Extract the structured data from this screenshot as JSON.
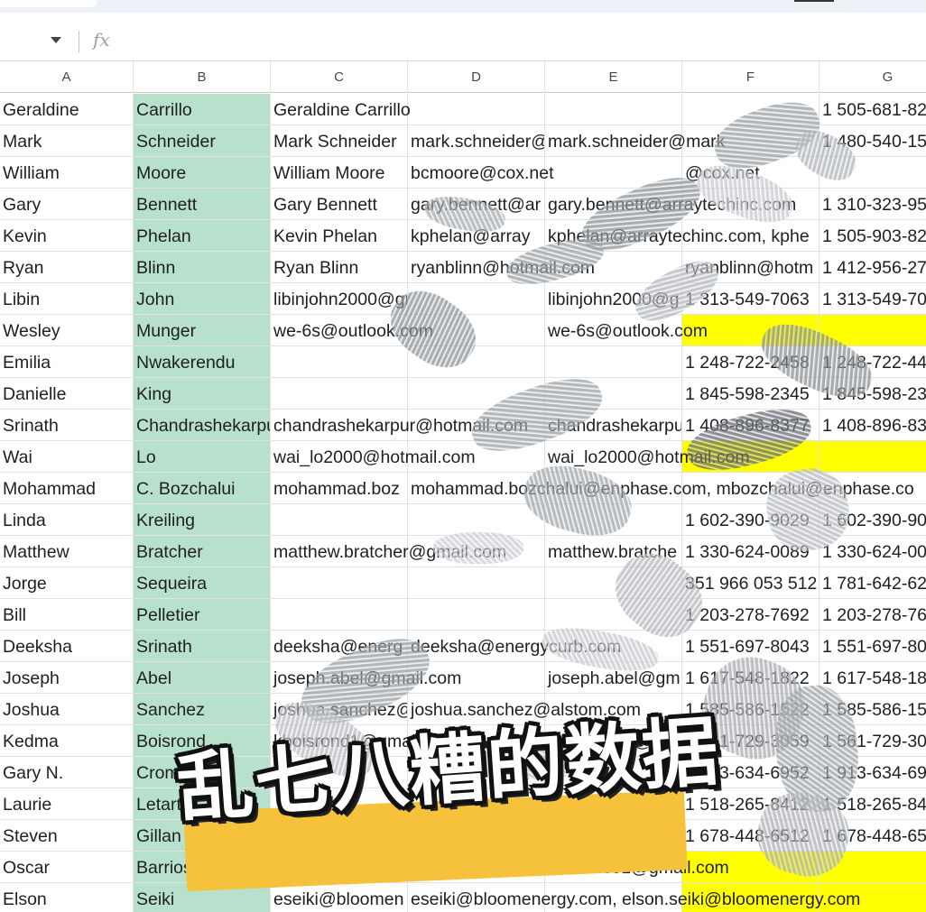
{
  "formula_bar": {
    "fx_label": "fx",
    "value": ""
  },
  "columns": [
    "A",
    "B",
    "C",
    "D",
    "E",
    "F",
    "G"
  ],
  "rows": [
    [
      "Geraldine",
      "Carrillo",
      "Geraldine Carrillo",
      "",
      "",
      "",
      "1 505-681-82"
    ],
    [
      "Mark",
      "Schneider",
      "Mark Schneider",
      "mark.schneider@",
      "mark.schneider@mark",
      "",
      "1 480-540-15"
    ],
    [
      "William",
      "Moore",
      "William Moore",
      "bcmoore@cox.net",
      "",
      "@cox.net",
      ""
    ],
    [
      "Gary",
      "Bennett",
      "Gary Bennett",
      "gary.bennett@ar",
      "gary.bennett@arraytechinc.com",
      "",
      "1 310-323-95"
    ],
    [
      "Kevin",
      "Phelan",
      "Kevin Phelan",
      "kphelan@array",
      "kphelan@arraytechinc.com, kphe",
      "",
      "1 505-903-82"
    ],
    [
      "Ryan",
      "Blinn",
      "Ryan Blinn",
      "ryanblinn@hotmail.com",
      "",
      "ryanblinn@hotm",
      "1 412-956-27"
    ],
    [
      "Libin",
      "John",
      "libinjohn2000@gmail.com",
      "",
      "libinjohn2000@g",
      "1 313-549-7063",
      "1 313-549-70"
    ],
    [
      "Wesley",
      "Munger",
      "we-6s@outlook.com",
      "",
      "we-6s@outlook.com",
      "",
      ""
    ],
    [
      "Emilia",
      "Nwakerendu",
      "",
      "",
      "",
      "1 248-722-2458",
      "1 248-722-44"
    ],
    [
      "Danielle",
      "King",
      "",
      "",
      "",
      "1 845-598-2345",
      "1 845-598-23"
    ],
    [
      "Srinath",
      "Chandrashekarpur",
      "chandrashekarpur@hotmail.com",
      "",
      "chandrashekarpu",
      "1 408-896-8377",
      "1 408-896-83"
    ],
    [
      "Wai",
      "Lo",
      "wai_lo2000@hotmail.com",
      "",
      "wai_lo2000@hotmail.com",
      "",
      ""
    ],
    [
      "Mohammad",
      "C. Bozchalui",
      "mohammad.boz",
      "mohammad.bozchalui@enphase.com, mbozchalui@enphase.co",
      "",
      "",
      ""
    ],
    [
      "Linda",
      "Kreiling",
      "",
      "",
      "",
      "1 602-390-9029",
      "1 602-390-90"
    ],
    [
      "Matthew",
      "Bratcher",
      "matthew.bratcher@gmail.com",
      "",
      "matthew.bratche",
      "1 330-624-0089",
      "1 330-624-00"
    ],
    [
      "Jorge",
      "Sequeira",
      "",
      "",
      "",
      "351 966 053 512",
      "1 781-642-62"
    ],
    [
      "Bill",
      "Pelletier",
      "",
      "",
      "",
      "1 203-278-7692",
      "1 203-278-76"
    ],
    [
      "Deeksha",
      "Srinath",
      "deeksha@energ",
      "deeksha@energycurb.com",
      "",
      "1 551-697-8043",
      "1 551-697-80"
    ],
    [
      "Joseph",
      "Abel",
      "joseph.abel@gmail.com",
      "",
      "joseph.abel@gm",
      "1 617-548-1822",
      "1 617-548-18"
    ],
    [
      "Joshua",
      "Sanchez",
      "joshua.sanchez@",
      "joshua.sanchez@alstom.com",
      "",
      "1 585-586-1522",
      "1 585-586-15"
    ],
    [
      "Kedma",
      "Boisrond",
      "kboisrond1@gmail.com",
      "",
      "kboisrond1@gm",
      "1 561-729-3059",
      "1 561-729-30"
    ],
    [
      "Gary N.",
      "Cromer",
      "",
      "",
      "",
      "1 913-634-6952",
      "1 913-634-69"
    ],
    [
      "Laurie",
      "Letarte",
      "",
      "",
      "",
      "1 518-265-8412",
      "1 518-265-84"
    ],
    [
      "Steven",
      "Gillan",
      "",
      "",
      "",
      "1 678-448-6512",
      "1 678-448-65"
    ],
    [
      "Oscar",
      "Barrios",
      "obarrios01@gmail.com",
      "",
      "obarrios01@gmail.com",
      "",
      ""
    ],
    [
      "Elson",
      "Seiki",
      "eseiki@bloomen",
      "eseiki@bloomenergy.com, elson.seiki@bloomenergy.com",
      "",
      "",
      ""
    ]
  ],
  "banner": {
    "text": "乱七八糟的数据"
  },
  "colors": {
    "teal": "#b7e1cd",
    "yellow": "#ffff00",
    "banner_stripe": "#f6c23c"
  }
}
